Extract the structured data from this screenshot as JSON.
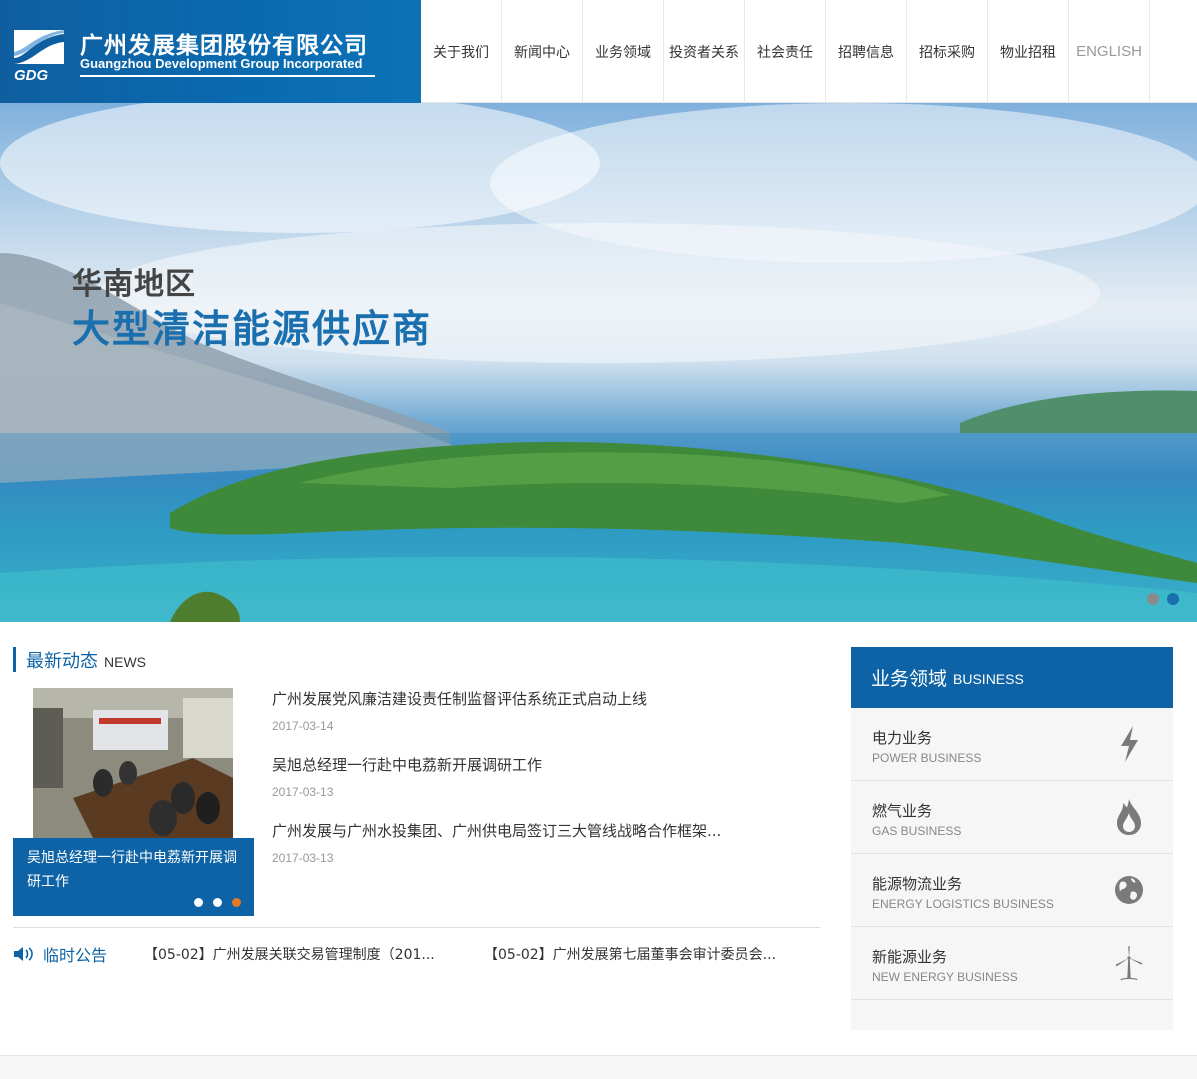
{
  "brand": {
    "cn": "广州发展集团股份有限公司",
    "en": "Guangzhou Development Group Incorporated",
    "mark": "GDG"
  },
  "nav": [
    "关于我们",
    "新闻中心",
    "业务领域",
    "投资者关系",
    "社会责任",
    "招聘信息",
    "招标采购",
    "物业招租",
    "ENGLISH"
  ],
  "banner": {
    "line1": "华南地区",
    "line2": "大型清洁能源供应商",
    "slides": 2,
    "active_slide": 2
  },
  "news": {
    "title_cn": "最新动态",
    "title_en": "NEWS",
    "caption": "吴旭总经理一行赴中电荔新开展调研工作",
    "caption_dots": 3,
    "caption_active": 3,
    "items": [
      {
        "title": "广州发展党风廉洁建设责任制监督评估系统正式启动上线",
        "date": "2017-03-14"
      },
      {
        "title": "吴旭总经理一行赴中电荔新开展调研工作",
        "date": "2017-03-13"
      },
      {
        "title": "广州发展与广州水投集团、广州供电局签订三大管线战略合作框架...",
        "date": "2017-03-13"
      }
    ]
  },
  "notice": {
    "label": "临时公告",
    "items": [
      "【05-02】广州发展关联交易管理制度（201...",
      "【05-02】广州发展第七届董事会审计委员会..."
    ]
  },
  "business": {
    "title_cn": "业务领域",
    "title_en": "BUSINESS",
    "items": [
      {
        "cn": "电力业务",
        "en": "POWER BUSINESS",
        "icon": "lightning-icon"
      },
      {
        "cn": "燃气业务",
        "en": "GAS BUSINESS",
        "icon": "flame-icon"
      },
      {
        "cn": "能源物流业务",
        "en": "ENERGY LOGISTICS BUSINESS",
        "icon": "globe-icon"
      },
      {
        "cn": "新能源业务",
        "en": "NEW ENERGY BUSINESS",
        "icon": "wind-turbine-icon"
      }
    ]
  },
  "colors": {
    "brand_blue": "#0d63a5",
    "accent_orange": "#e87722"
  }
}
